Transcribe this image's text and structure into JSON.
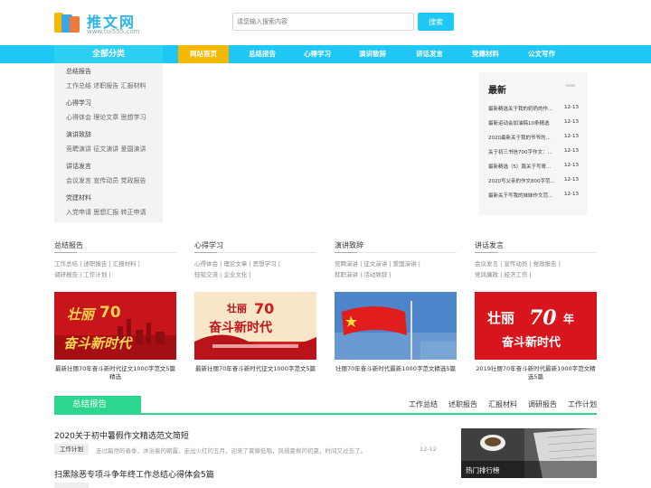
{
  "header": {
    "site_name": "推文网",
    "site_url": "www.tui555.com",
    "search_placeholder": "请您输入搜索内容",
    "search_button": "搜索"
  },
  "nav": {
    "all_categories": "全部分类",
    "items": [
      "网站首页",
      "总结报告",
      "心得学习",
      "演讲致辞",
      "讲话发言",
      "党建材料",
      "公文写作"
    ],
    "active_index": 0
  },
  "category_panel": [
    {
      "title": "总结报告",
      "links": "工作总结 述职报告 汇报材料"
    },
    {
      "title": "心得学习",
      "links": "心得体会 理论文章 思想学习"
    },
    {
      "title": "演讲致辞",
      "links": "竞聘演讲 征文演讲 爱国演讲"
    },
    {
      "title": "讲话发言",
      "links": "会议发言 宣传动员 党政报告"
    },
    {
      "title": "党建材料",
      "links": "入党申请 思想汇报 转正申请"
    }
  ],
  "newest": {
    "title": "最新",
    "sub": "news",
    "items": [
      {
        "t": "最新精选关于我的奶奶的作...",
        "d": "12-13"
      },
      {
        "t": "最新运动会加油稿10条精选",
        "d": "12-13"
      },
      {
        "t": "2020最新关于我的爷爷的...",
        "d": "12-13"
      },
      {
        "t": "关于初三书信700字作文：...",
        "d": "12-13"
      },
      {
        "t": "最新精选（5）篇关于写哥...",
        "d": "12-13"
      },
      {
        "t": "2020写父亲的作文800字范...",
        "d": "12-13"
      },
      {
        "t": "最新关于写我的妹妹作文范...",
        "d": "12-13"
      }
    ]
  },
  "columns": [
    {
      "title": "总结报告",
      "line1": "工作总结 | 述职报告 | 汇报材料 |",
      "line2": "调研报告 | 工作计划 |"
    },
    {
      "title": "心得学习",
      "line1": "心得体会 | 理论文章 | 思想学习 |",
      "line2": "轻毯交流 | 企业文化 |"
    },
    {
      "title": "演讲致辞",
      "line1": "竞聘演讲 | 征文演讲 | 爱国演讲 |",
      "line2": "就职演讲 | 活动致辞 |"
    },
    {
      "title": "讲话发言",
      "line1": "会议发言 | 宣传动员 | 党政报告 |",
      "line2": "党风廉政 | 经济工作 |"
    }
  ],
  "banners": [
    {
      "text": "壮丽70年 奋斗新时代",
      "caption": "最新壮丽70年奋斗新时代征文1000字范文5篇精选"
    },
    {
      "text": "壮丽70年 奋斗新时代",
      "caption": "最新壮丽70年奋斗新时代征文1000字范文5篇"
    },
    {
      "text": "",
      "caption": "壮丽70年奋斗新时代最新1000字范文精选5篇"
    },
    {
      "text": "壮丽70年 奋斗新时代",
      "caption": "2019壮丽70年奋斗新时代最新1000字范文精选5篇"
    }
  ],
  "section": {
    "title": "总结报告",
    "links": [
      "工作总结",
      "述职报告",
      "汇报材料",
      "调研报告",
      "工作计划"
    ]
  },
  "articles": [
    {
      "title": "2020关于初中暑假作文精选范文简短",
      "tag": "工作计划",
      "summary": "走过黯然的春季，沐浴着的朝露，走出火红的五月，迎来了夏蝉低唱，风摇夏柳的初夏，时间又过去了。",
      "date": "12-12"
    },
    {
      "title": "扫黑除恶专项斗争年终工作总结心得体会5篇",
      "tag": "",
      "summary": "",
      "date": ""
    }
  ],
  "hot": {
    "title": "热门排行榜"
  },
  "colors": {
    "brand": "#1fc7f4",
    "active": "#f5b800",
    "section": "#2cd68f"
  }
}
